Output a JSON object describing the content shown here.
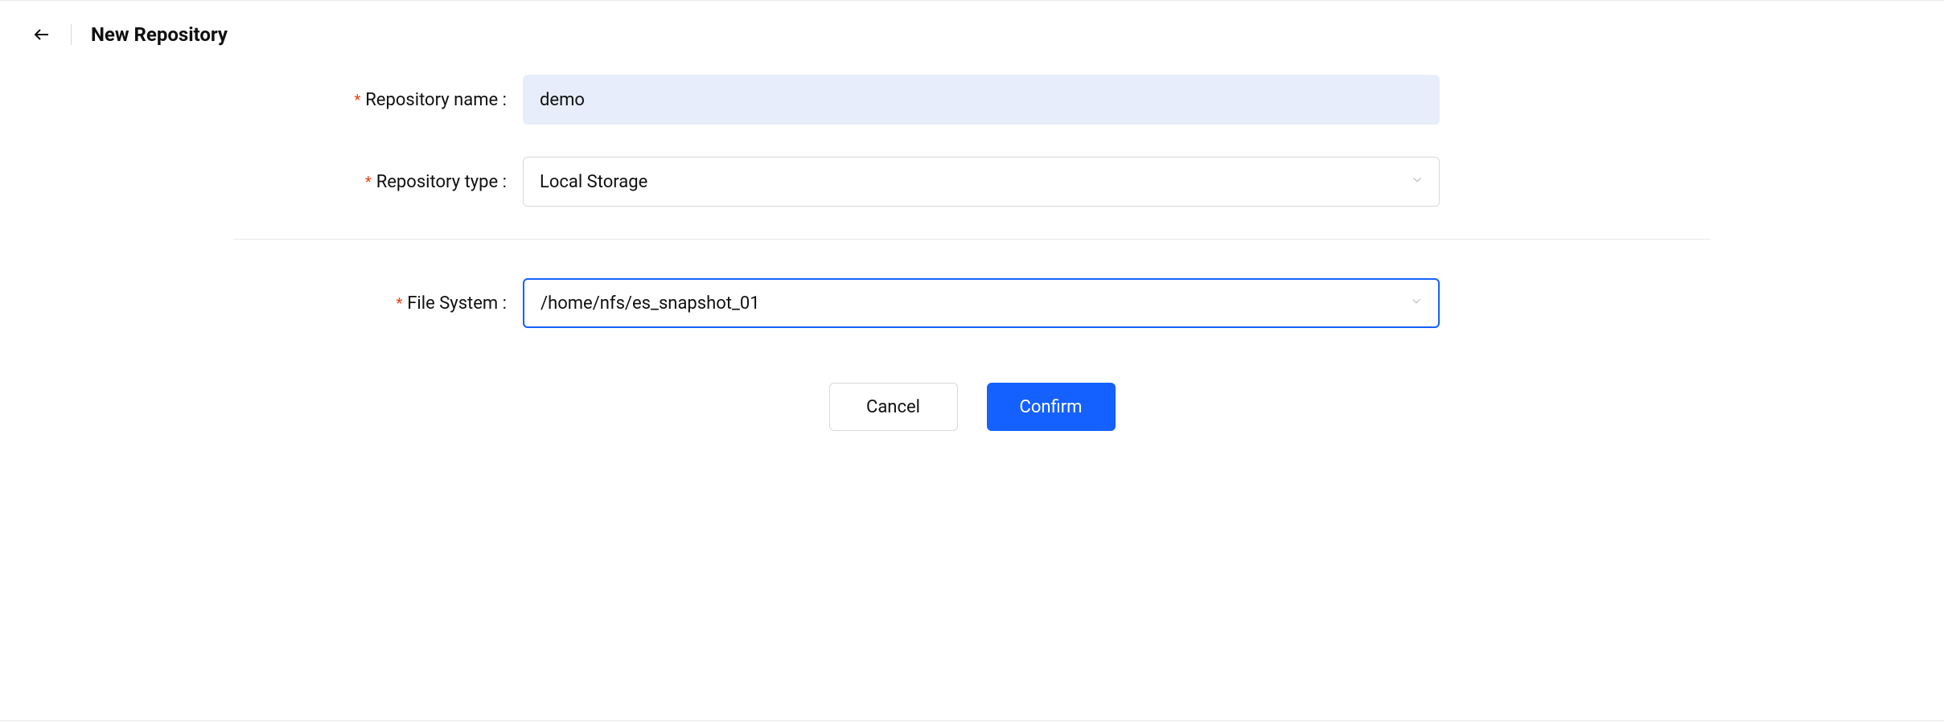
{
  "header": {
    "title": "New Repository"
  },
  "form": {
    "name": {
      "label": "Repository name",
      "value": "demo"
    },
    "type": {
      "label": "Repository type",
      "value": "Local Storage"
    },
    "fs": {
      "label": "File System",
      "value": "/home/nfs/es_snapshot_01"
    }
  },
  "actions": {
    "cancel": "Cancel",
    "confirm": "Confirm"
  }
}
